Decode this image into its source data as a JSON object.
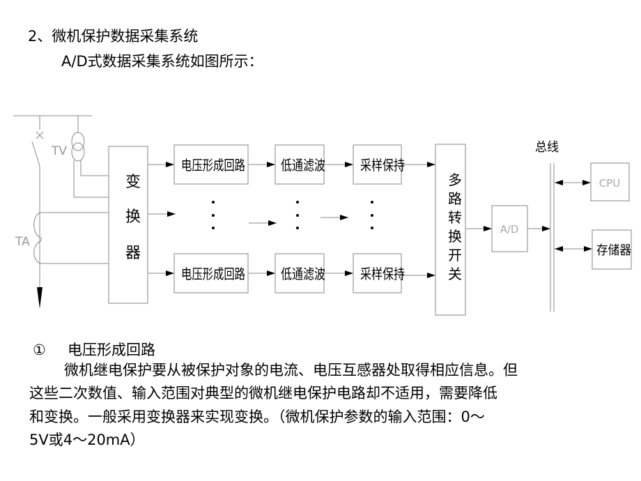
{
  "slide": {
    "heading": "2、微机保护数据采集系统",
    "subheading": "A/D式数据采集系统如图所示：",
    "diagram": {
      "bus_label": "总线",
      "tv_label": "TV",
      "ta_label": "TA",
      "converter_label": [
        "变",
        "换",
        "器"
      ],
      "voltage_circuit_label": "电压形成回路",
      "lowpass_label": "低通滤波",
      "sample_hold_label": "采样保持",
      "mux_label": [
        "多",
        "路",
        "转",
        "换",
        "开",
        "关"
      ],
      "ad_label": "A/D",
      "cpu_label": "CPU",
      "memory_label": "存储器"
    },
    "section": {
      "number": "①",
      "title": "电压形成回路",
      "lines": [
        "微机继电保护要从被保护对象的电流、电压互感器处取得相应信息。但",
        "这些二次数值、输入范围对典型的微机继电保护电路却不适用，需要降低",
        "和变换。一般采用变换器来实现变换。（微机保护参数的输入范围：0～",
        "5V或4～20mA）"
      ]
    }
  }
}
